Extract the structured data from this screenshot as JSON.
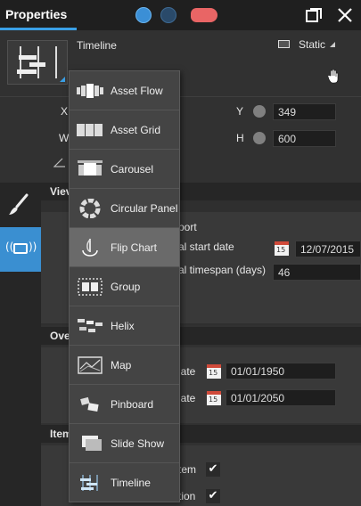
{
  "window": {
    "title": "Properties",
    "accent": "#3aa0e6"
  },
  "header": {
    "component_name": "Timeline",
    "mode_label": "Static"
  },
  "position": {
    "x_label": "X",
    "y_label": "Y",
    "y_value": "349",
    "w_label": "W",
    "h_label": "H",
    "h_value": "600"
  },
  "sections": {
    "view_title": "Viev",
    "view_rows": [
      {
        "label": "port"
      },
      {
        "label": "al start date",
        "value": "12/07/2015",
        "calendar_day": "15"
      },
      {
        "label": "al timespan (days)",
        "value": "46"
      }
    ],
    "overview_title": "Ove",
    "overview_rows": [
      {
        "label": "late",
        "value": "01/01/1950",
        "calendar_day": "15"
      },
      {
        "label": "late",
        "value": "01/01/2050",
        "calendar_day": "15"
      }
    ],
    "items_title": "Item",
    "items_rows": [
      {
        "label": "tem",
        "checked": "✔"
      },
      {
        "label": "tion",
        "checked": "✔"
      }
    ]
  },
  "menu": {
    "items": [
      {
        "label": "Asset Flow",
        "icon": "asset-flow-icon"
      },
      {
        "label": "Asset Grid",
        "icon": "asset-grid-icon"
      },
      {
        "label": "Carousel",
        "icon": "carousel-icon"
      },
      {
        "label": "Circular Panel",
        "icon": "circular-panel-icon"
      },
      {
        "label": "Flip Chart",
        "icon": "flip-chart-icon",
        "hover": true
      },
      {
        "label": "Group",
        "icon": "group-icon"
      },
      {
        "label": "Helix",
        "icon": "helix-icon"
      },
      {
        "label": "Map",
        "icon": "map-icon"
      },
      {
        "label": "Pinboard",
        "icon": "pinboard-icon"
      },
      {
        "label": "Slide Show",
        "icon": "slide-show-icon"
      },
      {
        "label": "Timeline",
        "icon": "timeline-icon"
      }
    ]
  }
}
